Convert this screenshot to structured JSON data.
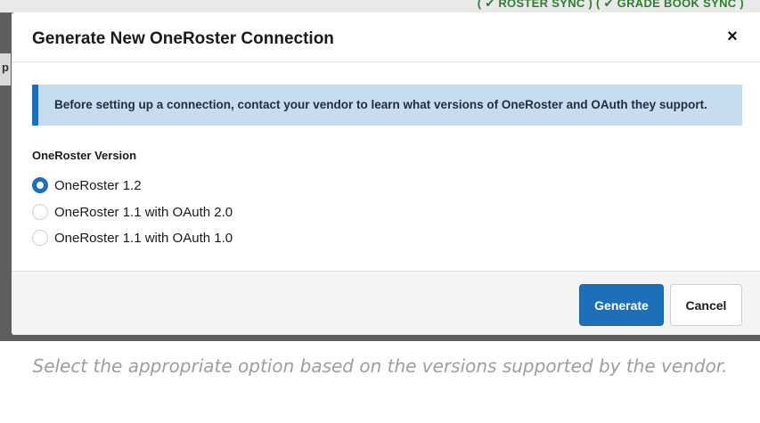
{
  "background": {
    "tags_text": "( ✔ ROSTER SYNC ) ( ✔ GRADE BOOK SYNC )",
    "left_glyph": "p"
  },
  "modal": {
    "title": "Generate New OneRoster Connection",
    "close_symbol": "×",
    "alert_text": "Before setting up a connection, contact your vendor to learn what versions of OneRoster and OAuth they support.",
    "version_label": "OneRoster Version",
    "options": [
      {
        "label": "OneRoster 1.2",
        "checked": true
      },
      {
        "label": "OneRoster 1.1 with OAuth 2.0",
        "checked": false
      },
      {
        "label": "OneRoster 1.1 with OAuth 1.0",
        "checked": false
      }
    ],
    "buttons": {
      "generate": "Generate",
      "cancel": "Cancel"
    }
  },
  "caption": "Select the appropriate option based on the versions supported by the vendor.",
  "colors": {
    "primary": "#1d6fb8",
    "alert_bg": "#c8dcf0",
    "tag_green": "#2e7d32"
  }
}
